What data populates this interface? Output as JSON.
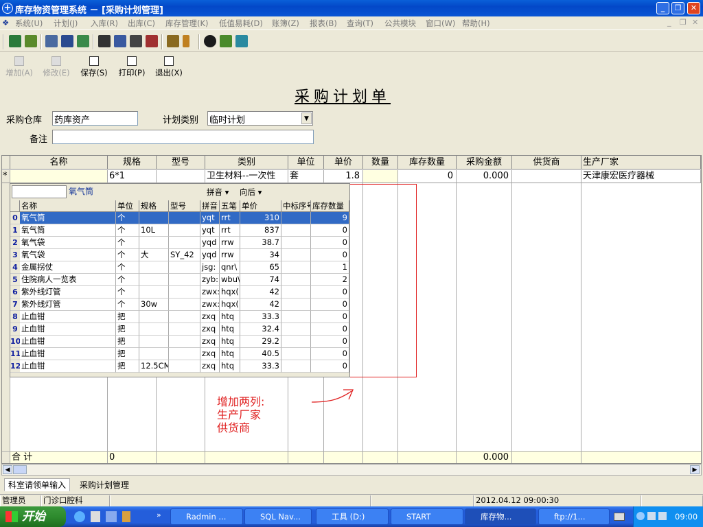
{
  "window": {
    "title": "库存物资管理系统 － [采购计划管理]"
  },
  "menubar": {
    "items": [
      "系统(U)",
      "计划(J)",
      "入库(R)",
      "出库(C)",
      "库存管理(K)",
      "低值易耗(D)",
      "账簿(Z)",
      "报表(B)",
      "查询(T)",
      "公共模块",
      "窗口(W)",
      "帮助(H)"
    ]
  },
  "toolbar2": {
    "add": "增加(A)",
    "edit": "修改(E)",
    "save": "保存(S)",
    "print": "打印(P)",
    "exit": "退出(X)"
  },
  "form": {
    "title": "采购计划单",
    "warehouse_label": "采购仓库",
    "warehouse_value": "药库资产",
    "plantype_label": "计划类别",
    "plantype_value": "临时计划",
    "remark_label": "备注",
    "remark_value": ""
  },
  "grid": {
    "headers": [
      "名称",
      "规格",
      "型号",
      "类别",
      "单位",
      "单价",
      "数量",
      "库存数量",
      "采购金额",
      "供货商",
      "生产厂家"
    ],
    "row": {
      "marker": "*",
      "name": "",
      "spec": "6*1",
      "model": "",
      "category": "卫生材料--一次性",
      "unit": "套",
      "price": "1.8",
      "qty": "",
      "stock": "0",
      "amount": "0.000",
      "supplier": "",
      "maker": "天津康宏医疗器械"
    },
    "total": {
      "label": "合  计",
      "spec": "0",
      "amount": "0.000"
    }
  },
  "popup": {
    "search_value": "",
    "keyword": "氧气筒",
    "pinyin": "拼音",
    "order": "向后",
    "headers": [
      "名称",
      "单位",
      "规格",
      "型号",
      "拼音",
      "五笔",
      "单价",
      "中标序号",
      "库存数量"
    ],
    "rows": [
      {
        "idx": "0",
        "name": "氧气筒",
        "unit": "个",
        "spec": "",
        "model": "",
        "py": "yqt",
        "wb": "rrt",
        "price": "310",
        "zb": "",
        "stock": "9"
      },
      {
        "idx": "1",
        "name": "氧气筒",
        "unit": "个",
        "spec": "10L",
        "model": "",
        "py": "yqt",
        "wb": "rrt",
        "price": "837",
        "zb": "",
        "stock": "0"
      },
      {
        "idx": "2",
        "name": "氧气袋",
        "unit": "个",
        "spec": "",
        "model": "",
        "py": "yqd",
        "wb": "rrw",
        "price": "38.7",
        "zb": "",
        "stock": "0"
      },
      {
        "idx": "3",
        "name": "氧气袋",
        "unit": "个",
        "spec": "大",
        "model": "SY_42",
        "py": "yqd",
        "wb": "rrw",
        "price": "34",
        "zb": "",
        "stock": "0"
      },
      {
        "idx": "4",
        "name": "金属拐仗",
        "unit": "个",
        "spec": "",
        "model": "",
        "py": "jsg:",
        "wb": "qnr\\",
        "price": "65",
        "zb": "",
        "stock": "1"
      },
      {
        "idx": "5",
        "name": "住院病人一览表",
        "unit": "个",
        "spec": "",
        "model": "",
        "py": "zyb:",
        "wb": "wbu\\",
        "price": "74",
        "zb": "",
        "stock": "2"
      },
      {
        "idx": "6",
        "name": "紫外线灯管",
        "unit": "个",
        "spec": "",
        "model": "",
        "py": "zwx:",
        "wb": "hqx(",
        "price": "42",
        "zb": "",
        "stock": "0"
      },
      {
        "idx": "7",
        "name": "紫外线灯管",
        "unit": "个",
        "spec": "30w",
        "model": "",
        "py": "zwx:",
        "wb": "hqx(",
        "price": "42",
        "zb": "",
        "stock": "0"
      },
      {
        "idx": "8",
        "name": "止血钳",
        "unit": "把",
        "spec": "",
        "model": "",
        "py": "zxq",
        "wb": "htq",
        "price": "33.3",
        "zb": "",
        "stock": "0"
      },
      {
        "idx": "9",
        "name": "止血钳",
        "unit": "把",
        "spec": "",
        "model": "",
        "py": "zxq",
        "wb": "htq",
        "price": "32.4",
        "zb": "",
        "stock": "0"
      },
      {
        "idx": "10",
        "name": "止血钳",
        "unit": "把",
        "spec": "",
        "model": "",
        "py": "zxq",
        "wb": "htq",
        "price": "29.2",
        "zb": "",
        "stock": "0"
      },
      {
        "idx": "11",
        "name": "止血钳",
        "unit": "把",
        "spec": "",
        "model": "",
        "py": "zxq",
        "wb": "htq",
        "price": "40.5",
        "zb": "",
        "stock": "0"
      },
      {
        "idx": "12",
        "name": "止血钳",
        "unit": "把",
        "spec": "12.5CM",
        "model": "",
        "py": "zxq",
        "wb": "htq",
        "price": "33.3",
        "zb": "",
        "stock": "0"
      }
    ]
  },
  "annotation": {
    "line1": "增加两列:",
    "line2": "生产厂家",
    "line3": "供货商",
    "color": "#e02020"
  },
  "tabs": [
    "科室请领单输入",
    "采购计划管理"
  ],
  "status": {
    "user": "管理员",
    "dept": "门诊口腔科",
    "datetime": "2012.04.12 09:00:30"
  },
  "taskbar": {
    "start": "开始",
    "items": [
      "Radmin ...",
      "SQL Nav...",
      "工具 (D:)",
      "START",
      "库存物...",
      "ftp://1..."
    ],
    "clock": "09:00"
  }
}
